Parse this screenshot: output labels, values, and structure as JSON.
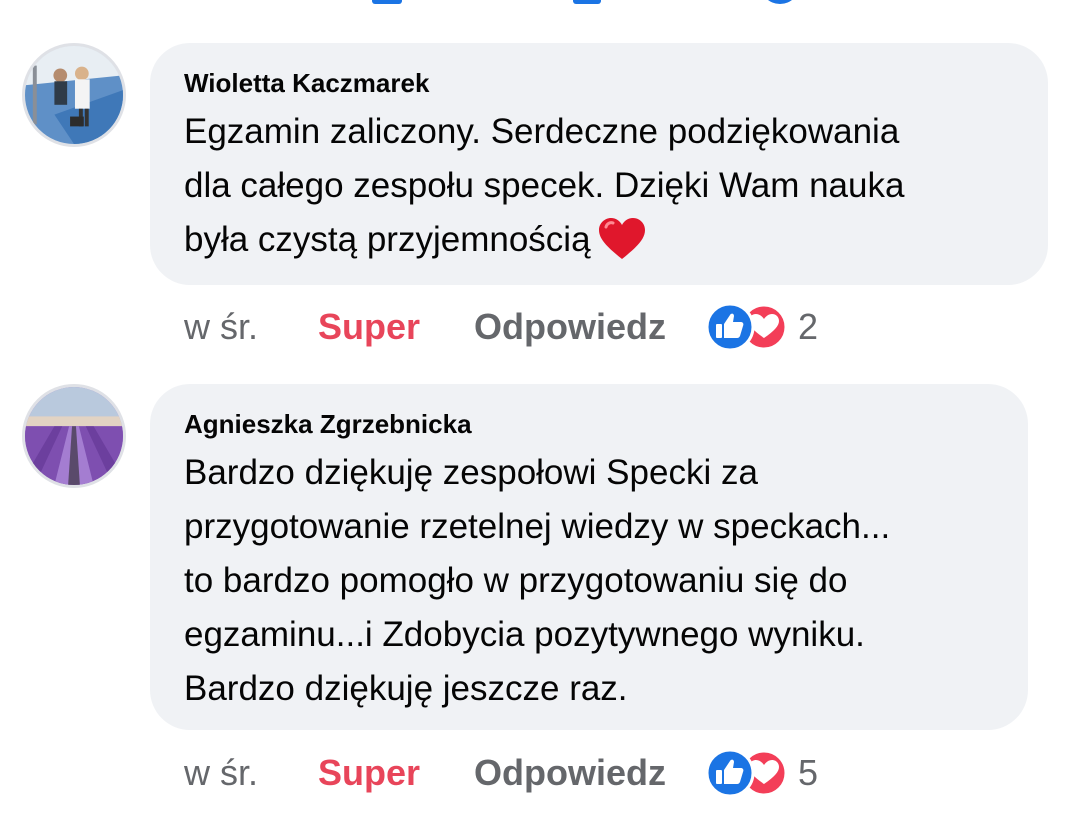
{
  "comments": [
    {
      "author": "Wioletta Kaczmarek",
      "avatar_icon": "user-photo-avatar",
      "text_lines": [
        "Egzamin zaliczony.  Serdeczne podziękowania",
        "dla całego zespołu specek. Dzięki Wam  nauka",
        "była czystą przyjemnością"
      ],
      "emoji": "red-heart-icon",
      "time": "w śr.",
      "reaction_label": "Super",
      "reply_label": "Odpowiedz",
      "reaction_icons": [
        "like-icon",
        "love-icon"
      ],
      "reaction_count": "2"
    },
    {
      "author": "Agnieszka Zgrzebnicka",
      "avatar_icon": "lavender-field-avatar",
      "text_lines": [
        "Bardzo dziękuję zespołowi Specki za",
        "przygotowanie rzetelnej wiedzy w speckach...",
        "to bardzo pomogło w przygotowaniu się do",
        "egzaminu...i  Zdobycia  pozytywnego wyniku.",
        "Bardzo dziękuję jeszcze raz."
      ],
      "time": "w śr.",
      "reaction_label": "Super",
      "reply_label": "Odpowiedz",
      "reaction_icons": [
        "like-icon",
        "love-icon"
      ],
      "reaction_count": "5"
    }
  ],
  "colors": {
    "bubble_bg": "#f0f2f5",
    "super_red": "#e8455a",
    "secondary_text": "#65676b",
    "like_blue": "#1b74e4",
    "love_red": "#f33e58"
  }
}
